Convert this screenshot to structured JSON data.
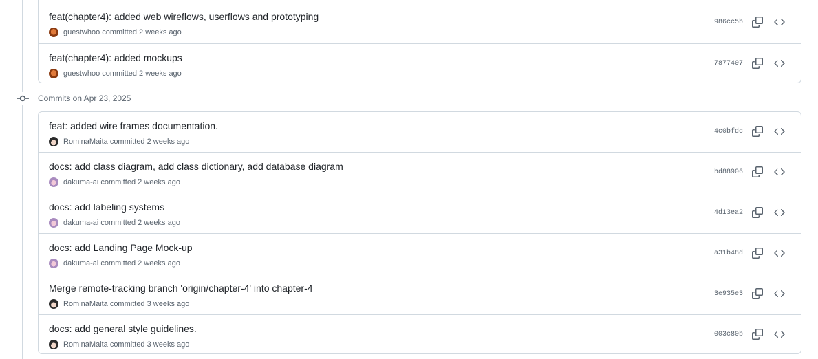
{
  "groups": [
    {
      "date_label": "",
      "commits": [
        {
          "message": "feat(chapter4): added web wireflows, userflows and prototyping",
          "author": "guestwhoo",
          "action": "committed",
          "time": "2 weeks ago",
          "sha": "986cc5b",
          "avatar": "gw"
        },
        {
          "message": "feat(chapter4): added mockups",
          "author": "guestwhoo",
          "action": "committed",
          "time": "2 weeks ago",
          "sha": "7877407",
          "avatar": "gw"
        }
      ]
    },
    {
      "date_label": "Commits on Apr 23, 2025",
      "commits": [
        {
          "message": "feat: added wire frames documentation.",
          "author": "RominaMaita",
          "action": "committed",
          "time": "2 weeks ago",
          "sha": "4c0bfdc",
          "avatar": "rm"
        },
        {
          "message": "docs: add class diagram, add class dictionary, add database diagram",
          "author": "dakuma-ai",
          "action": "committed",
          "time": "2 weeks ago",
          "sha": "bd88906",
          "avatar": "dk"
        },
        {
          "message": "docs: add labeling systems",
          "author": "dakuma-ai",
          "action": "committed",
          "time": "2 weeks ago",
          "sha": "4d13ea2",
          "avatar": "dk"
        },
        {
          "message": "docs: add Landing Page Mock-up",
          "author": "dakuma-ai",
          "action": "committed",
          "time": "2 weeks ago",
          "sha": "a31b48d",
          "avatar": "dk"
        },
        {
          "message": "Merge remote-tracking branch 'origin/chapter-4' into chapter-4",
          "author": "RominaMaita",
          "action": "committed",
          "time": "3 weeks ago",
          "sha": "3e935e3",
          "avatar": "rm"
        },
        {
          "message": "docs: add general style guidelines.",
          "author": "RominaMaita",
          "action": "committed",
          "time": "3 weeks ago",
          "sha": "003c80b",
          "avatar": "rm"
        }
      ]
    }
  ],
  "icons": {
    "copy": "copy-icon",
    "browse": "code-icon",
    "commit": "git-commit-icon"
  },
  "colors": {
    "border": "#d1d9e0",
    "muted": "#59636e",
    "text": "#1f2328"
  }
}
